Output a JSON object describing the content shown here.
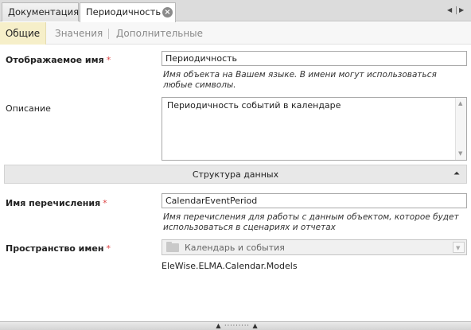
{
  "doc_tabs": [
    {
      "label": "Документация"
    },
    {
      "label": "Периодичность"
    }
  ],
  "section_tabs": [
    {
      "label": "Общие"
    },
    {
      "label": "Значения"
    },
    {
      "label": "Дополнительные"
    }
  ],
  "display_name": {
    "label": "Отображаемое имя",
    "required": "*",
    "value": "Периодичность",
    "hint": "Имя объекта на Вашем языке. В имени могут использоваться любые символы."
  },
  "description": {
    "label": "Описание",
    "value": "Периодичность событий в календаре"
  },
  "data_structure": {
    "title": "Структура данных"
  },
  "enum_name": {
    "label": "Имя перечисления",
    "required": "*",
    "value": "CalendarEventPeriod",
    "hint": "Имя перечисления для работы с данным объектом, которое будет использоваться в сценариях и отчетах"
  },
  "namespace": {
    "label": "Пространство имен",
    "required": "*",
    "selected": "Календарь и события",
    "full_path": "EleWise.ELMA.Calendar.Models"
  },
  "icons": [
    "close-icon",
    "arrow-left-icon",
    "arrow-right-icon",
    "collapse-up-icon",
    "folder-icon",
    "dropdown-arrow-icon",
    "scroll-up-icon",
    "scroll-down-icon",
    "splitter-grip-icon"
  ],
  "colors": {
    "active_section_tab": "#f6efc9",
    "required_mark": "#dd4444"
  }
}
